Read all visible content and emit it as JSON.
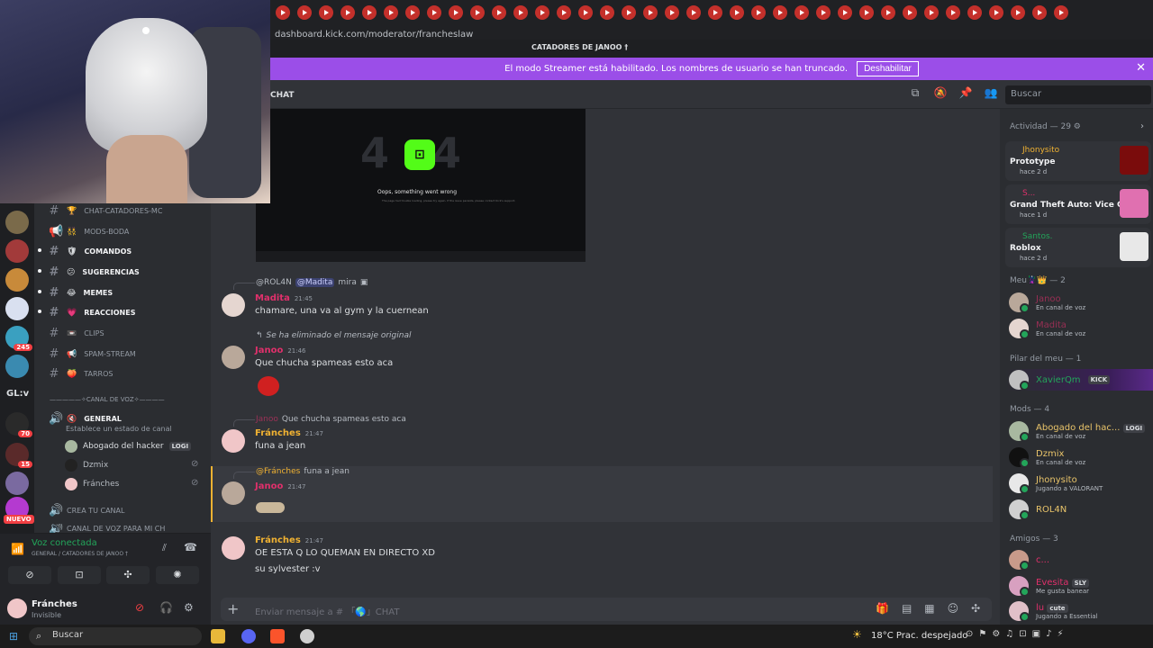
{
  "browser": {
    "url": "dashboard.kick.com/moderator/francheslaw"
  },
  "window": {
    "server_title": "CATADORES DE JANOO †"
  },
  "banner": {
    "text": "El modo Streamer está habilitado. Los nombres de usuario se han truncado.",
    "button": "Deshabilitar",
    "close": "✕"
  },
  "header": {
    "channel": "CHAT",
    "search_placeholder": "Buscar"
  },
  "rail": {
    "badges": [
      "245",
      "70",
      "15"
    ],
    "text_server": "GL:v",
    "new": "NUEVO"
  },
  "channels": [
    {
      "emoji": "🏆",
      "name": "chat-catadores-mc"
    },
    {
      "emoji": "👯",
      "name": "mods-boda"
    },
    {
      "emoji": "🛡",
      "name": "comandos"
    },
    {
      "emoji": "😕",
      "name": "sugerencias"
    },
    {
      "emoji": "😂",
      "name": "memes"
    },
    {
      "emoji": "💗",
      "name": "reacciones"
    },
    {
      "emoji": "📼",
      "name": "clips"
    },
    {
      "emoji": "📢",
      "name": "spam-stream"
    },
    {
      "emoji": "🍑",
      "name": "tarros"
    }
  ],
  "voice_category": "—————✧CANAL DE VOZ✧————",
  "voice_channel": {
    "emoji": "🔇",
    "name": "GENERAL",
    "status": "Establece un estado de canal"
  },
  "voice_users": [
    {
      "name": "Abogado del hacker",
      "tag": "LOGI"
    },
    {
      "name": "Dzmix",
      "tag": ""
    },
    {
      "name": "Fránches",
      "tag": ""
    }
  ],
  "extra_channels": [
    "CREA TU CANAL",
    "CANAL DE VOZ PARA MI CH"
  ],
  "voice_panel": {
    "title": "Voz conectada",
    "subtitle": "GENERAL / CATADORES DE JANOO †"
  },
  "user_panel": {
    "name": "Fránches",
    "status": "Invisible"
  },
  "embed404": {
    "digits": "44",
    "message": "Oops, something went wrong",
    "sub": "The page had trouble loading, please try again. If the issue persists, please contact Kick's support."
  },
  "messages": [
    {
      "reply_author": "@ROL4N",
      "reply_mention": "@Madita",
      "reply_text": "mira",
      "author": "Madita",
      "time": "21:45",
      "text": "chamare, una va al gym y la cuernean"
    },
    {
      "reply_text": "Se ha eliminado el mensaje original",
      "author": "Janoo",
      "time": "21:46",
      "text": "Que chucha spameas esto aca"
    },
    {
      "reply_author": "Janoo",
      "reply_text": "Que chucha spameas esto aca",
      "author": "Fránches",
      "time": "21:47",
      "text": "funa a jean"
    },
    {
      "reply_author": "@Fránches",
      "reply_text": "funa a jean",
      "author": "Janoo",
      "time": "21:47"
    },
    {
      "author": "Fránches",
      "time": "21:47",
      "text": "OE ESTA Q LO QUEMAN EN DIRECTO XD",
      "text2": "su sylvester :v"
    }
  ],
  "composer": {
    "placeholder": "Enviar mensaje a # 「🌎」CHAT"
  },
  "members": {
    "activity_header": "Actividad — 29",
    "activities": [
      {
        "user": "Jhonysito",
        "game": "Prototype",
        "time": "hace 2 d"
      },
      {
        "user": "S...",
        "game": "Grand Theft Auto: Vice City",
        "time": "hace 1 d"
      },
      {
        "user": "Santos.",
        "game": "Roblox",
        "time": "hace 2 d"
      }
    ],
    "meu_header": "Meu🦹👑 — 2",
    "meu": [
      {
        "name": "Janoo",
        "sub": "En canal de voz"
      },
      {
        "name": "Madita",
        "sub": "En canal de voz"
      }
    ],
    "pilar_header": "Pilar del meu — 1",
    "pilar": [
      {
        "name": "XavierQm",
        "tag": "KICK"
      }
    ],
    "mods_header": "Mods — 4",
    "mods": [
      {
        "name": "Abogado del hac...",
        "tag": "LOGI",
        "sub": "En canal de voz"
      },
      {
        "name": "Dzmix",
        "sub": "En canal de voz"
      },
      {
        "name": "Jhonysito",
        "sub": "Jugando a VALORANT"
      },
      {
        "name": "ROL4N",
        "sub": ""
      }
    ],
    "amigos_header": "Amigos — 3",
    "amigos": [
      {
        "name": "c...",
        "sub": ""
      },
      {
        "name": "Evesita",
        "tag": "SLY",
        "sub": "Me gusta banear"
      },
      {
        "name": "lu",
        "tag": "cute",
        "sub": "Jugando a Essential"
      }
    ]
  },
  "taskbar": {
    "search": "Buscar",
    "weather": "18°C  Prac. despejado"
  }
}
